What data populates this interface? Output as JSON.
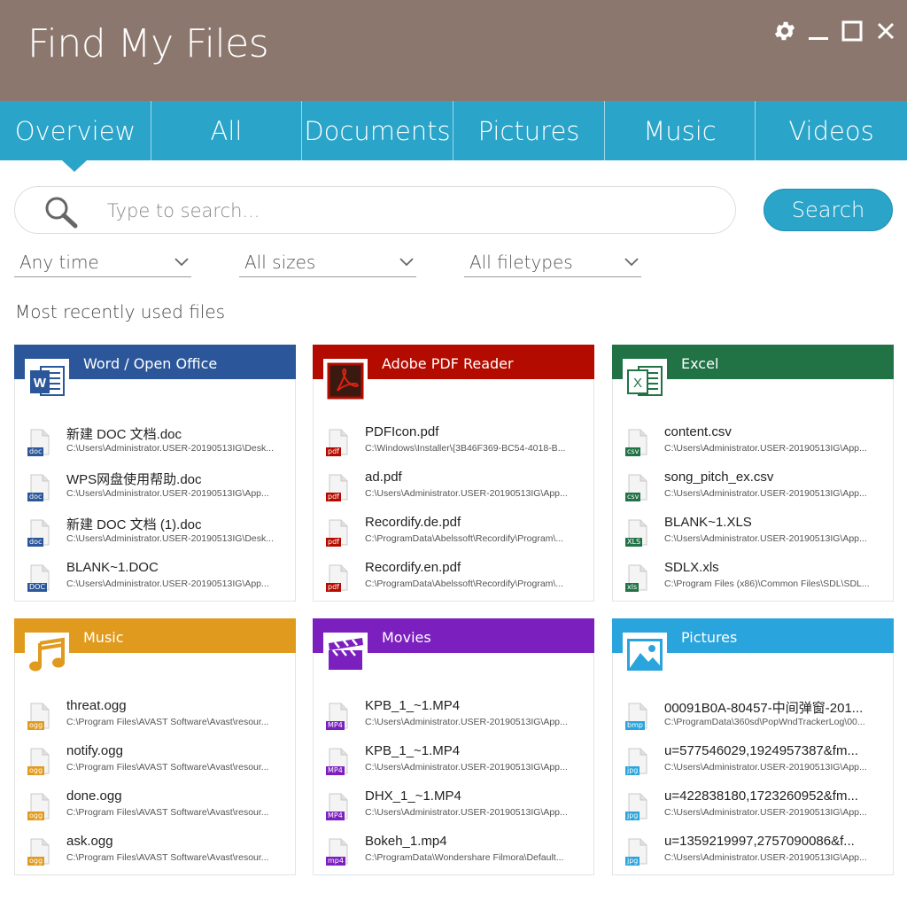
{
  "app": {
    "title": "Find My Files"
  },
  "tabs": [
    {
      "label": "Overview",
      "width": 171
    },
    {
      "label": "All",
      "width": 170
    },
    {
      "label": "Documents",
      "width": 171
    },
    {
      "label": "Pictures",
      "width": 171
    },
    {
      "label": "Music",
      "width": 170
    },
    {
      "label": "Videos",
      "width": 171
    }
  ],
  "search": {
    "placeholder": "Type to search...",
    "button_label": "Search"
  },
  "filters": {
    "time": "Any time",
    "size": "All sizes",
    "type": "All filetypes"
  },
  "section_title": "Most recently used files",
  "cards": [
    {
      "title": "Word / Open Office",
      "color": "#2b579a",
      "files": [
        {
          "ext": "doc",
          "name": "新建 DOC 文档.doc",
          "path": "C:\\Users\\Administrator.USER-20190513IG\\Desk..."
        },
        {
          "ext": "doc",
          "name": "WPS网盘使用帮助.doc",
          "path": "C:\\Users\\Administrator.USER-20190513IG\\App..."
        },
        {
          "ext": "doc",
          "name": "新建 DOC 文档 (1).doc",
          "path": "C:\\Users\\Administrator.USER-20190513IG\\Desk..."
        },
        {
          "ext": "DOC",
          "name": "BLANK~1.DOC",
          "path": "C:\\Users\\Administrator.USER-20190513IG\\App..."
        }
      ]
    },
    {
      "title": "Adobe PDF Reader",
      "color": "#b30b00",
      "files": [
        {
          "ext": "pdf",
          "name": "PDFIcon.pdf",
          "path": "C:\\Windows\\Installer\\{3B46F369-BC54-4018-B..."
        },
        {
          "ext": "pdf",
          "name": "ad.pdf",
          "path": "C:\\Users\\Administrator.USER-20190513IG\\App..."
        },
        {
          "ext": "pdf",
          "name": "Recordify.de.pdf",
          "path": "C:\\ProgramData\\Abelssoft\\Recordify\\Program\\..."
        },
        {
          "ext": "pdf",
          "name": "Recordify.en.pdf",
          "path": "C:\\ProgramData\\Abelssoft\\Recordify\\Program\\..."
        }
      ]
    },
    {
      "title": "Excel",
      "color": "#217346",
      "files": [
        {
          "ext": "csv",
          "name": "content.csv",
          "path": "C:\\Users\\Administrator.USER-20190513IG\\App..."
        },
        {
          "ext": "csv",
          "name": "song_pitch_ex.csv",
          "path": "C:\\Users\\Administrator.USER-20190513IG\\App..."
        },
        {
          "ext": "XLS",
          "name": "BLANK~1.XLS",
          "path": "C:\\Users\\Administrator.USER-20190513IG\\App..."
        },
        {
          "ext": "xls",
          "name": "SDLX.xls",
          "path": "C:\\Program Files (x86)\\Common Files\\SDL\\SDL..."
        }
      ]
    },
    {
      "title": "Music",
      "color": "#e09a1e",
      "files": [
        {
          "ext": "ogg",
          "name": "threat.ogg",
          "path": "C:\\Program Files\\AVAST Software\\Avast\\resour..."
        },
        {
          "ext": "ogg",
          "name": "notify.ogg",
          "path": "C:\\Program Files\\AVAST Software\\Avast\\resour..."
        },
        {
          "ext": "ogg",
          "name": "done.ogg",
          "path": "C:\\Program Files\\AVAST Software\\Avast\\resour..."
        },
        {
          "ext": "ogg",
          "name": "ask.ogg",
          "path": "C:\\Program Files\\AVAST Software\\Avast\\resour..."
        }
      ]
    },
    {
      "title": "Movies",
      "color": "#7b1fbf",
      "files": [
        {
          "ext": "MP4",
          "name": "KPB_1_~1.MP4",
          "path": "C:\\Users\\Administrator.USER-20190513IG\\App..."
        },
        {
          "ext": "MP4",
          "name": "KPB_1_~1.MP4",
          "path": "C:\\Users\\Administrator.USER-20190513IG\\App..."
        },
        {
          "ext": "MP4",
          "name": "DHX_1_~1.MP4",
          "path": "C:\\Users\\Administrator.USER-20190513IG\\App..."
        },
        {
          "ext": "mp4",
          "name": "Bokeh_1.mp4",
          "path": "C:\\ProgramData\\Wondershare Filmora\\Default..."
        }
      ]
    },
    {
      "title": "Pictures",
      "color": "#2aa4dc",
      "files": [
        {
          "ext": "bmp",
          "name": "00091B0A-80457-中间弹窗-201...",
          "path": "C:\\ProgramData\\360sd\\PopWndTrackerLog\\00..."
        },
        {
          "ext": "jpg",
          "name": "u=577546029,1924957387&fm...",
          "path": "C:\\Users\\Administrator.USER-20190513IG\\App..."
        },
        {
          "ext": "jpg",
          "name": "u=422838180,1723260952&fm...",
          "path": "C:\\Users\\Administrator.USER-20190513IG\\App..."
        },
        {
          "ext": "jpg",
          "name": "u=1359219997,2757090086&f...",
          "path": "C:\\Users\\Administrator.USER-20190513IG\\App..."
        }
      ]
    }
  ]
}
